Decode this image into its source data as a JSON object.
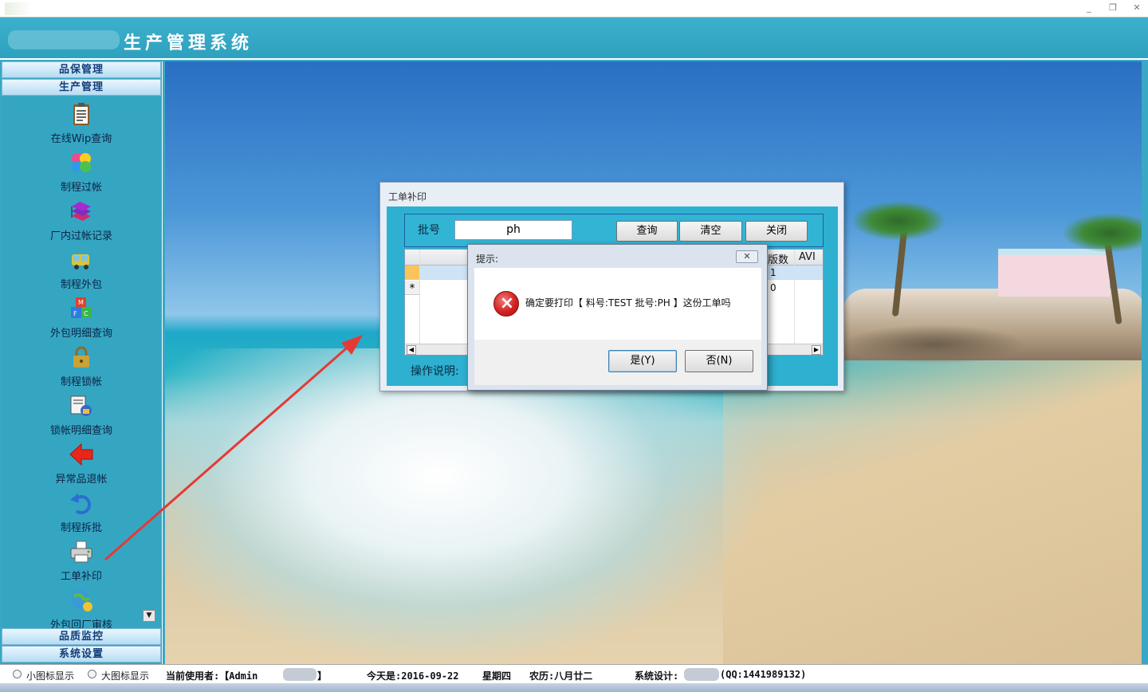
{
  "app": {
    "title": "生产管理系统"
  },
  "window": {
    "minimize": "_",
    "restore": "❐",
    "close": "✕"
  },
  "sidebar": {
    "top_sections": [
      "品保管理",
      "生产管理"
    ],
    "items": [
      {
        "label": "在线Wip查询",
        "icon": "clipboard-icon"
      },
      {
        "label": "制程过帐",
        "icon": "colorful-clover-icon"
      },
      {
        "label": "厂内过帐记录",
        "icon": "books-icon"
      },
      {
        "label": "制程外包",
        "icon": "truck-icon"
      },
      {
        "label": "外包明细查询",
        "icon": "blocks-icon"
      },
      {
        "label": "制程锁帐",
        "icon": "padlock-icon"
      },
      {
        "label": "锁帐明细查询",
        "icon": "lock-detail-icon"
      },
      {
        "label": "异常品退帐",
        "icon": "red-arrow-left-icon"
      },
      {
        "label": "制程拆批",
        "icon": "undo-icon"
      },
      {
        "label": "工单补印",
        "icon": "printer-icon"
      },
      {
        "label": "外包回厂审核",
        "icon": "globe-check-icon"
      }
    ],
    "scroll_down": "▼",
    "bottom_sections": [
      "品质监控",
      "系统设置"
    ]
  },
  "workorder_dialog": {
    "title": "工单补印",
    "batch_label": "批号",
    "batch_value": "ph",
    "query_button": "查询",
    "clear_button": "清空",
    "close_button": "关闭",
    "columns": [
      "版数",
      "AVI前"
    ],
    "rows": [
      {
        "ver": "1",
        "avi": ""
      },
      {
        "ver": "0",
        "avi": ""
      }
    ],
    "new_row_marker": "*",
    "scroll_left": "◀",
    "scroll_right": "▶",
    "description_label": "操作说明:"
  },
  "confirm_dialog": {
    "title": "提示:",
    "close": "✕",
    "message": "确定要打印【 料号:TEST  批号:PH 】这份工单吗",
    "yes_button": "是(Y)",
    "no_button": "否(N)"
  },
  "status_bar": {
    "small_icon_label": "小图标显示",
    "large_icon_label": "大图标显示",
    "user_label": "当前使用者:【Admin",
    "user_tail": "】",
    "today": "今天是:2016-09-22",
    "weekday": "星期四",
    "lunar": "农历:八月廿二",
    "designer_label": "系统设计:",
    "designer_qq": "(QQ:1441989132)"
  },
  "colors": {
    "header_bg": "#2da1be",
    "sidebar_text": "#0b2447",
    "nav_head_text": "#123e7a",
    "arrow": "#e53935"
  }
}
